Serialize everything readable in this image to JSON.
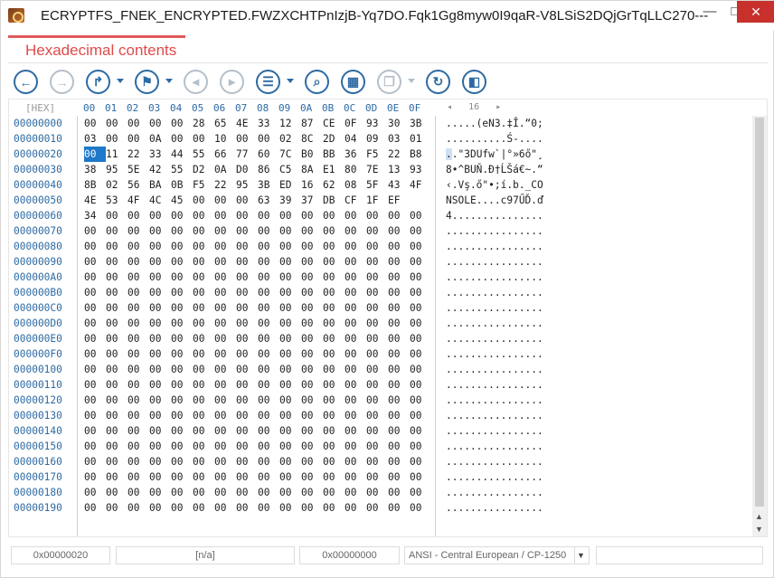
{
  "window": {
    "title": "ECRYPTFS_FNEK_ENCRYPTED.FWZXCHTPnIzjB-Yq7DO.Fqk1Gg8myw0I9qaR-V8LSiS2DQjGrTqLLC270---",
    "minimize": "—",
    "maximize": "□",
    "close": "✕"
  },
  "header": {
    "title": "Hexadecimal contents"
  },
  "toolbar": {
    "buttons": [
      {
        "name": "back",
        "icon": "arrow-left-icon",
        "glyph": "←",
        "enabled": true
      },
      {
        "name": "forward",
        "icon": "arrow-right-icon",
        "glyph": "→",
        "enabled": false
      },
      {
        "name": "goto",
        "icon": "goto-arrow-icon",
        "glyph": "↱",
        "enabled": true
      },
      {
        "name": "bookmark",
        "icon": "bookmark-icon",
        "glyph": "⚑",
        "enabled": true
      },
      {
        "name": "prev-bookmark",
        "icon": "prev-bookmark-icon",
        "glyph": "◂",
        "enabled": false
      },
      {
        "name": "next-bookmark",
        "icon": "next-bookmark-icon",
        "glyph": "▸",
        "enabled": false
      },
      {
        "name": "list",
        "icon": "list-icon",
        "glyph": "☰",
        "enabled": true
      },
      {
        "name": "search",
        "icon": "search-icon",
        "glyph": "⌕",
        "enabled": true
      },
      {
        "name": "columns",
        "icon": "columns-icon",
        "glyph": "▦",
        "enabled": true
      },
      {
        "name": "copy",
        "icon": "copy-icon",
        "glyph": "❐",
        "enabled": false
      },
      {
        "name": "refresh",
        "icon": "refresh-icon",
        "glyph": "↻",
        "enabled": true
      },
      {
        "name": "panel",
        "icon": "panel-toggle-icon",
        "glyph": "◧",
        "enabled": true
      }
    ]
  },
  "hex": {
    "label": "[HEX]",
    "columns": [
      "00",
      "01",
      "02",
      "03",
      "04",
      "05",
      "06",
      "07",
      "08",
      "09",
      "0A",
      "0B",
      "0C",
      "0D",
      "0E",
      "0F"
    ],
    "nav_prev": "◂",
    "bytes_per_row": "16",
    "nav_next": "▸",
    "rows": [
      {
        "offset": "00000000",
        "bytes": [
          "00",
          "00",
          "00",
          "00",
          "00",
          "28",
          "65",
          "4E",
          "33",
          "12",
          "87",
          "CE",
          "0F",
          "93",
          "30",
          "3B"
        ],
        "text": ".....(eN3.‡Î.“0;"
      },
      {
        "offset": "00000010",
        "bytes": [
          "03",
          "00",
          "00",
          "0A",
          "00",
          "00",
          "10",
          "00",
          "00",
          "02",
          "8C",
          "2D",
          "04",
          "09",
          "03",
          "01"
        ],
        "text": "..........Ś-...."
      },
      {
        "offset": "00000020",
        "bytes": [
          "00",
          "11",
          "22",
          "33",
          "44",
          "55",
          "66",
          "77",
          "60",
          "7C",
          "B0",
          "BB",
          "36",
          "F5",
          "22",
          "B8"
        ],
        "text": "..\"3DUfw`|°»6ő\"¸"
      },
      {
        "offset": "00000030",
        "bytes": [
          "38",
          "95",
          "5E",
          "42",
          "55",
          "D2",
          "0A",
          "D0",
          "86",
          "C5",
          "8A",
          "E1",
          "80",
          "7E",
          "13",
          "93"
        ],
        "text": "8•^BUŇ.Đ†ĹŠá€~.“"
      },
      {
        "offset": "00000040",
        "bytes": [
          "8B",
          "02",
          "56",
          "BA",
          "0B",
          "F5",
          "22",
          "95",
          "3B",
          "ED",
          "16",
          "62",
          "08",
          "5F",
          "43",
          "4F"
        ],
        "text": "‹.Vş.ő\"•;í.b._CO"
      },
      {
        "offset": "00000050",
        "bytes": [
          "4E",
          "53",
          "4F",
          "4C",
          "45",
          "00",
          "00",
          "00",
          "63",
          "39",
          "37",
          "DB",
          "CF",
          "1F",
          "EF",
          " "
        ],
        "text": "NSOLE....c97ŰĎ.ď"
      },
      {
        "offset": "00000060",
        "bytes": [
          "34",
          "00",
          "00",
          "00",
          "00",
          "00",
          "00",
          "00",
          "00",
          "00",
          "00",
          "00",
          "00",
          "00",
          "00",
          "00"
        ],
        "text": "4..............."
      },
      {
        "offset": "00000070",
        "bytes": [
          "00",
          "00",
          "00",
          "00",
          "00",
          "00",
          "00",
          "00",
          "00",
          "00",
          "00",
          "00",
          "00",
          "00",
          "00",
          "00"
        ],
        "text": "................"
      },
      {
        "offset": "00000080",
        "bytes": [
          "00",
          "00",
          "00",
          "00",
          "00",
          "00",
          "00",
          "00",
          "00",
          "00",
          "00",
          "00",
          "00",
          "00",
          "00",
          "00"
        ],
        "text": "................"
      },
      {
        "offset": "00000090",
        "bytes": [
          "00",
          "00",
          "00",
          "00",
          "00",
          "00",
          "00",
          "00",
          "00",
          "00",
          "00",
          "00",
          "00",
          "00",
          "00",
          "00"
        ],
        "text": "................"
      },
      {
        "offset": "000000A0",
        "bytes": [
          "00",
          "00",
          "00",
          "00",
          "00",
          "00",
          "00",
          "00",
          "00",
          "00",
          "00",
          "00",
          "00",
          "00",
          "00",
          "00"
        ],
        "text": "................"
      },
      {
        "offset": "000000B0",
        "bytes": [
          "00",
          "00",
          "00",
          "00",
          "00",
          "00",
          "00",
          "00",
          "00",
          "00",
          "00",
          "00",
          "00",
          "00",
          "00",
          "00"
        ],
        "text": "................"
      },
      {
        "offset": "000000C0",
        "bytes": [
          "00",
          "00",
          "00",
          "00",
          "00",
          "00",
          "00",
          "00",
          "00",
          "00",
          "00",
          "00",
          "00",
          "00",
          "00",
          "00"
        ],
        "text": "................"
      },
      {
        "offset": "000000D0",
        "bytes": [
          "00",
          "00",
          "00",
          "00",
          "00",
          "00",
          "00",
          "00",
          "00",
          "00",
          "00",
          "00",
          "00",
          "00",
          "00",
          "00"
        ],
        "text": "................"
      },
      {
        "offset": "000000E0",
        "bytes": [
          "00",
          "00",
          "00",
          "00",
          "00",
          "00",
          "00",
          "00",
          "00",
          "00",
          "00",
          "00",
          "00",
          "00",
          "00",
          "00"
        ],
        "text": "................"
      },
      {
        "offset": "000000F0",
        "bytes": [
          "00",
          "00",
          "00",
          "00",
          "00",
          "00",
          "00",
          "00",
          "00",
          "00",
          "00",
          "00",
          "00",
          "00",
          "00",
          "00"
        ],
        "text": "................"
      },
      {
        "offset": "00000100",
        "bytes": [
          "00",
          "00",
          "00",
          "00",
          "00",
          "00",
          "00",
          "00",
          "00",
          "00",
          "00",
          "00",
          "00",
          "00",
          "00",
          "00"
        ],
        "text": "................"
      },
      {
        "offset": "00000110",
        "bytes": [
          "00",
          "00",
          "00",
          "00",
          "00",
          "00",
          "00",
          "00",
          "00",
          "00",
          "00",
          "00",
          "00",
          "00",
          "00",
          "00"
        ],
        "text": "................"
      },
      {
        "offset": "00000120",
        "bytes": [
          "00",
          "00",
          "00",
          "00",
          "00",
          "00",
          "00",
          "00",
          "00",
          "00",
          "00",
          "00",
          "00",
          "00",
          "00",
          "00"
        ],
        "text": "................"
      },
      {
        "offset": "00000130",
        "bytes": [
          "00",
          "00",
          "00",
          "00",
          "00",
          "00",
          "00",
          "00",
          "00",
          "00",
          "00",
          "00",
          "00",
          "00",
          "00",
          "00"
        ],
        "text": "................"
      },
      {
        "offset": "00000140",
        "bytes": [
          "00",
          "00",
          "00",
          "00",
          "00",
          "00",
          "00",
          "00",
          "00",
          "00",
          "00",
          "00",
          "00",
          "00",
          "00",
          "00"
        ],
        "text": "................"
      },
      {
        "offset": "00000150",
        "bytes": [
          "00",
          "00",
          "00",
          "00",
          "00",
          "00",
          "00",
          "00",
          "00",
          "00",
          "00",
          "00",
          "00",
          "00",
          "00",
          "00"
        ],
        "text": "................"
      },
      {
        "offset": "00000160",
        "bytes": [
          "00",
          "00",
          "00",
          "00",
          "00",
          "00",
          "00",
          "00",
          "00",
          "00",
          "00",
          "00",
          "00",
          "00",
          "00",
          "00"
        ],
        "text": "................"
      },
      {
        "offset": "00000170",
        "bytes": [
          "00",
          "00",
          "00",
          "00",
          "00",
          "00",
          "00",
          "00",
          "00",
          "00",
          "00",
          "00",
          "00",
          "00",
          "00",
          "00"
        ],
        "text": "................"
      },
      {
        "offset": "00000180",
        "bytes": [
          "00",
          "00",
          "00",
          "00",
          "00",
          "00",
          "00",
          "00",
          "00",
          "00",
          "00",
          "00",
          "00",
          "00",
          "00",
          "00"
        ],
        "text": "................"
      },
      {
        "offset": "00000190",
        "bytes": [
          "00",
          "00",
          "00",
          "00",
          "00",
          "00",
          "00",
          "00",
          "00",
          "00",
          "00",
          "00",
          "00",
          "00",
          "00",
          "00"
        ],
        "text": "................"
      }
    ],
    "selected": {
      "row": 2,
      "col": 0
    }
  },
  "status": {
    "cursor_offset": "0x00000020",
    "value": "[n/a]",
    "selection_offset": "0x00000000",
    "encoding": "ANSI - Central European / CP-1250",
    "extra": ""
  }
}
